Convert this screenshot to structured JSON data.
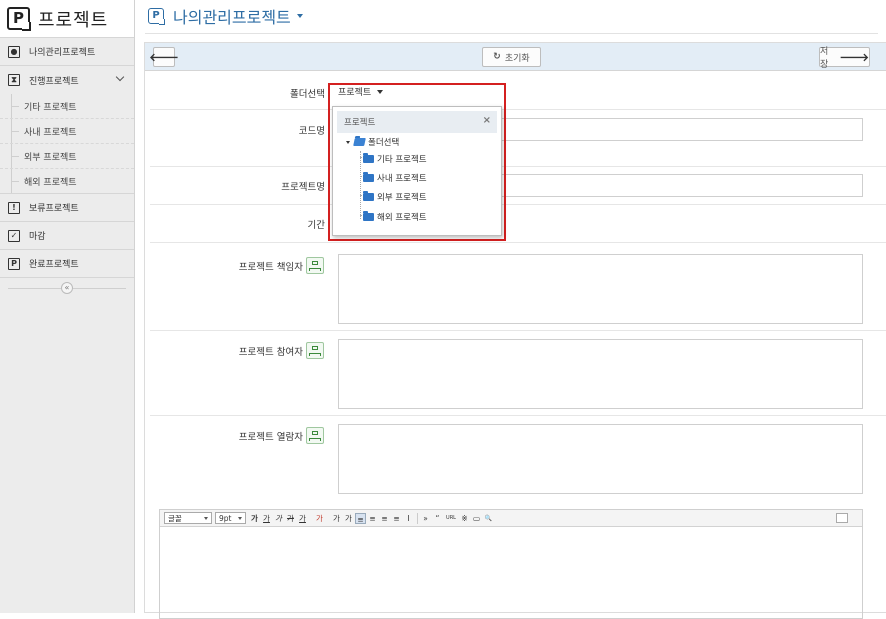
{
  "sidebar": {
    "logo_letter": "P",
    "title": "프로젝트",
    "items": [
      {
        "label": "나의관리프로젝트",
        "icon": "person-icon"
      },
      {
        "label": "진행프로젝트",
        "icon": "hourglass-icon"
      },
      {
        "label": "보류프로젝트",
        "icon": "exclamation-icon"
      },
      {
        "label": "마감",
        "icon": "checkbox-icon"
      },
      {
        "label": "완료프로젝트",
        "icon": "project-complete-icon"
      }
    ],
    "sub_items": [
      "기타 프로젝트",
      "사내 프로젝트",
      "외부 프로젝트",
      "해외 프로젝트"
    ],
    "collapse_glyph": "«"
  },
  "page": {
    "logo_letter": "P",
    "title": "나의관리프로젝트"
  },
  "toolbar": {
    "back_glyph": "🡐",
    "reset_label": "초기화",
    "reset_glyph": "↻",
    "save_label": "저장",
    "save_glyph": "🡒"
  },
  "form": {
    "folder_label": "폴더선택",
    "folder_value": "프로젝트",
    "code_label": "코드명",
    "name_label": "프로젝트명",
    "period_label": "기간",
    "manager_label": "프로젝트 책임자",
    "participant_label": "프로젝트 참여자",
    "viewer_label": "프로젝트 열람자"
  },
  "dropdown": {
    "header": "프로젝트",
    "close": "×",
    "root": "폴더선택",
    "children": [
      "기타 프로젝트",
      "사내 프로젝트",
      "외부 프로젝트",
      "해외 프로젝트"
    ]
  },
  "editor": {
    "font_select": "글꼴",
    "size_select": "9pt",
    "buttons": [
      "가",
      "가",
      "가",
      "가",
      "가",
      "가",
      "가",
      "가",
      "≡",
      "≡",
      "≡",
      "≡",
      "I",
      "»",
      "“",
      "URL",
      "※",
      "▭",
      "🔍"
    ]
  },
  "colors": {
    "accent": "#2e6da4",
    "highlight_box": "#d42020",
    "toolbar_bg": "#e3edf6"
  }
}
